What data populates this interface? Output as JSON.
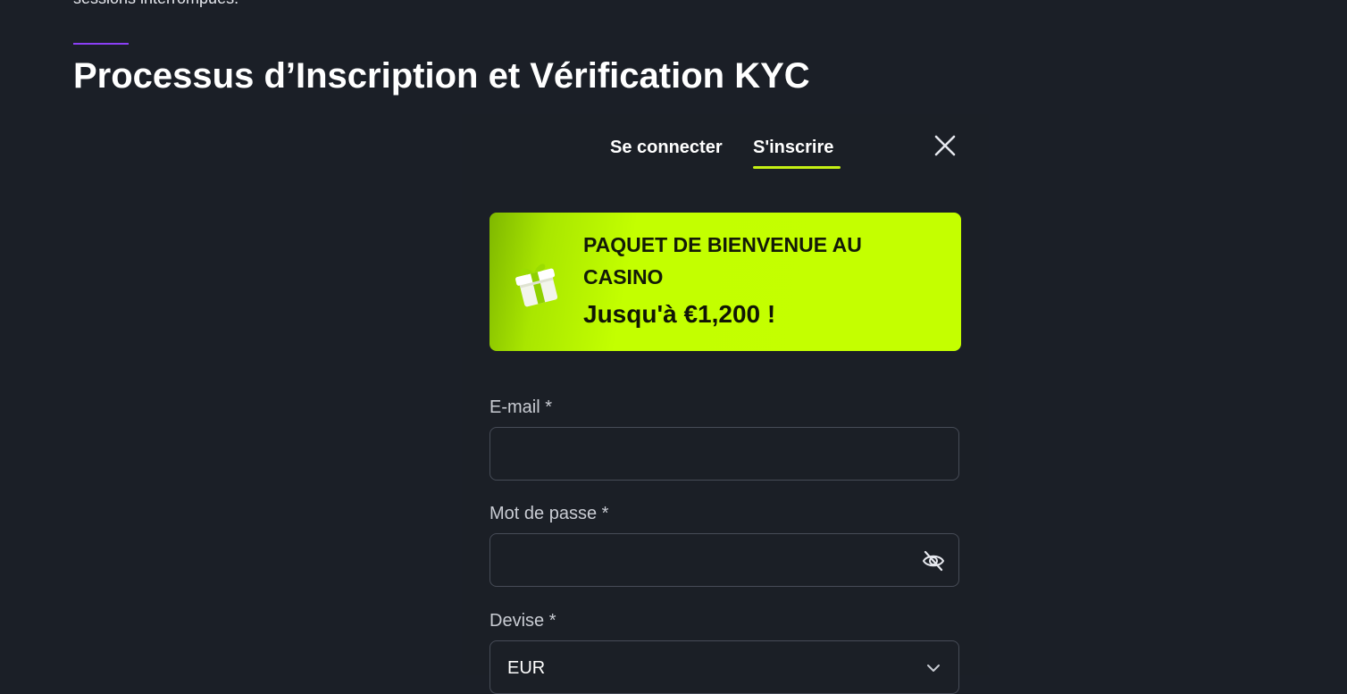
{
  "page": {
    "top_cut_text": "sessions interrompues.",
    "title": "Processus d’Inscription et Vérification KYC"
  },
  "modal": {
    "tabs": [
      {
        "label": "Se connecter",
        "active": false
      },
      {
        "label": "S'inscrire",
        "active": true
      }
    ],
    "close_icon": "close-icon",
    "promo": {
      "icon": "gift-icon",
      "title": "PAQUET DE BIENVENUE AU CASINO",
      "amount": "Jusqu'à €1,200 !"
    },
    "fields": {
      "email": {
        "label": "E-mail *",
        "value": "",
        "placeholder": ""
      },
      "password": {
        "label": "Mot de passe *",
        "value": "",
        "placeholder": "",
        "toggle_icon": "eye-off-icon"
      },
      "currency": {
        "label": "Devise *",
        "value": "EUR",
        "icon": "chevron-down-icon"
      }
    }
  },
  "colors": {
    "background": "#1b1f27",
    "accent_purple": "#8b3ff5",
    "accent_lime": "#c4ff00",
    "tab_underline": "#c6f014",
    "field_border": "#474c57",
    "label_text": "#c9ccd3"
  }
}
